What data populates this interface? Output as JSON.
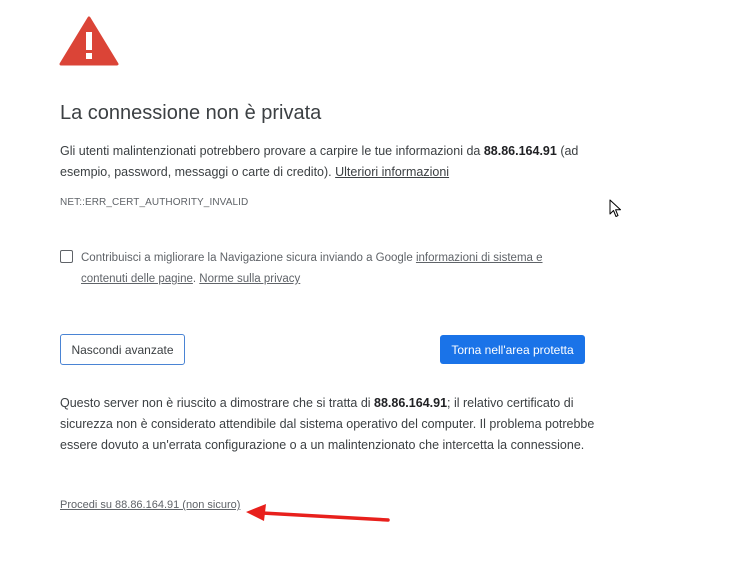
{
  "page": {
    "title": "La connessione non è privata",
    "intro_part1": "Gli utenti malintenzionati potrebbero provare a carpire le tue informazioni da ",
    "host": "88.86.164.91",
    "intro_part2": " (ad esempio, password, messaggi o carte di credito). ",
    "more_info_link": "Ulteriori informazioni",
    "error_code": "NET::ERR_CERT_AUTHORITY_INVALID"
  },
  "optin": {
    "checked": false,
    "text_before": "Contribuisci a migliorare la Navigazione sicura inviando a Google ",
    "system_info_link": "informazioni di sistema e contenuti delle pagine",
    "separator": ". ",
    "privacy_link": "Norme sulla privacy"
  },
  "buttons": {
    "hide_advanced": "Nascondi avanzate",
    "back_to_safety": "Torna nell'area protetta"
  },
  "details": {
    "part1": "Questo server non è riuscito a dimostrare che si tratta di ",
    "host": "88.86.164.91",
    "part2": "; il relativo certificato di sicurezza non è considerato attendibile dal sistema operativo del computer. Il problema potrebbe essere dovuto a un'errata configurazione o a un malintenzionato che intercetta la connessione."
  },
  "proceed_link": "Procedi su 88.86.164.91 (non sicuro)",
  "colors": {
    "warning_red": "#db4437",
    "primary_blue": "#1a73e8",
    "annotation_arrow": "#e8201c"
  },
  "icons": {
    "warning": "warning-triangle-icon",
    "annotation": "red-arrow-annotation",
    "cursor": "mouse-pointer-icon"
  }
}
